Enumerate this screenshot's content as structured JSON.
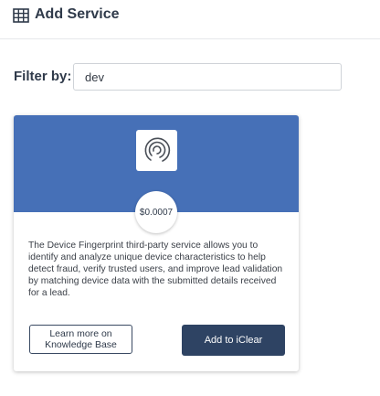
{
  "header": {
    "icon": "table-grid-icon",
    "title": "Add Service"
  },
  "filter": {
    "label": "Filter by:",
    "value": "dev"
  },
  "service_card": {
    "banner_color": "#4670b7",
    "logo_icon": "device-fingerprint-logo-icon",
    "price": "$0.0007",
    "description": "The Device Fingerprint third-party service allows you to identify and analyze unique device characteristics to help detect fraud, verify trusted users, and improve lead validation by matching device data with the submitted details received for a lead.",
    "learn_more_label": "Learn more on Knowledge Base",
    "add_label": "Add to iClear",
    "add_button_color": "#2e4363"
  }
}
